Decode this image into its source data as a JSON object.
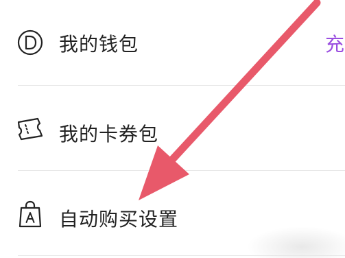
{
  "menu": {
    "items": [
      {
        "label": "我的钱包",
        "icon": "wallet-d-icon"
      },
      {
        "label": "我的卡券包",
        "icon": "ticket-icon"
      },
      {
        "label": "自动购买设置",
        "icon": "shopping-bag-a-icon"
      }
    ],
    "wallet_edge_text": "充"
  },
  "annotation": {
    "arrow_color": "#e8596a"
  },
  "colors": {
    "text": "#222222",
    "divider": "#e8e8e8",
    "accent": "#9a4ee0"
  }
}
